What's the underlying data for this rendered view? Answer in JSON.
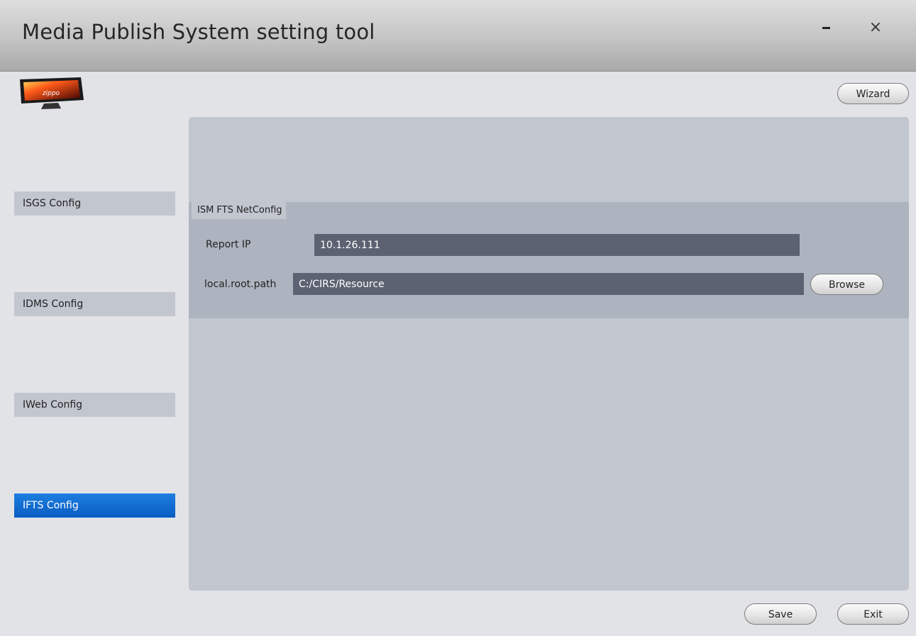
{
  "app": {
    "title": "Media Publish System setting tool",
    "minimize_icon": "minimize-icon",
    "close_icon": "×"
  },
  "logo": {
    "name": "tv-logo",
    "text": "zippo"
  },
  "toolbar": {
    "wizard_label": "Wizard"
  },
  "sidebar": {
    "items": [
      {
        "label": "ISGS Config",
        "active": false
      },
      {
        "label": "IDMS Config",
        "active": false
      },
      {
        "label": "IWeb Config",
        "active": false
      },
      {
        "label": "IFTS Config",
        "active": true
      }
    ]
  },
  "main": {
    "group_title": "ISM FTS NetConfig",
    "report_ip": {
      "label": "Report IP",
      "value": "10.1.26.111"
    },
    "local_root_path": {
      "label": "local.root.path",
      "value": "C:/CIRS/Resource"
    },
    "browse_label": "Browse"
  },
  "footer": {
    "save_label": "Save",
    "exit_label": "Exit"
  },
  "colors": {
    "active_nav": "#1473d6",
    "nav_bg": "#c2c6cf",
    "input_bg": "#5c6271",
    "group_bg": "#aeb4bf"
  }
}
